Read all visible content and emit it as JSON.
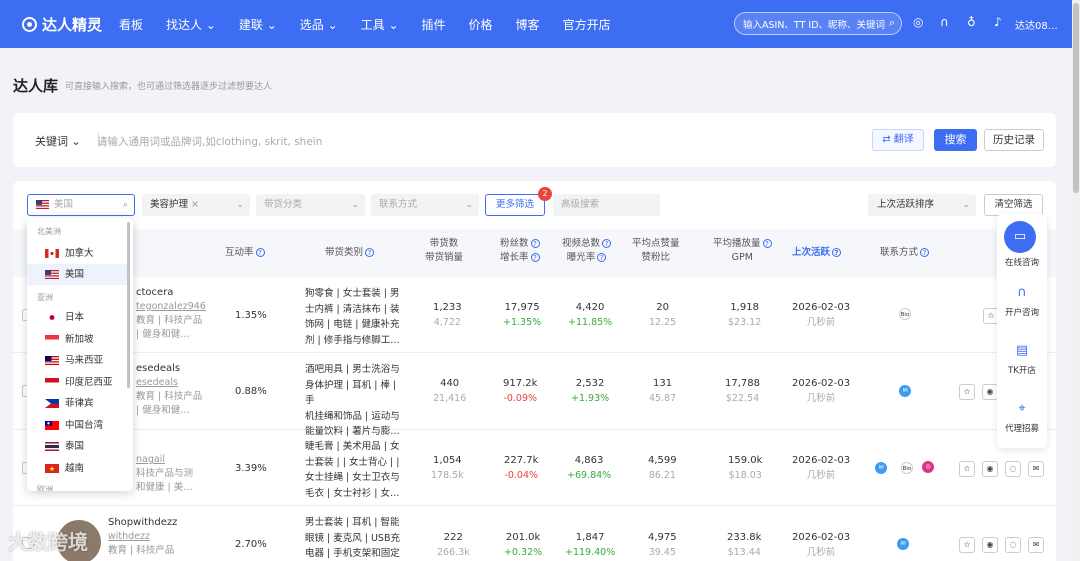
{
  "nav": {
    "brand": "达人精灵",
    "items": [
      "看板",
      "找达人 ⌄",
      "建联 ⌄",
      "选品 ⌄",
      "工具 ⌄",
      "插件",
      "价格",
      "博客",
      "官方开店"
    ],
    "search_placeholder": "输入ASIN、TT ID、昵称、关键词",
    "user": "达达08…"
  },
  "page": {
    "title": "达人库",
    "subtitle": "可直接输入搜索，也可通过筛选器逐步过滤想要达人"
  },
  "keyword": {
    "label": "关键词 ⌄",
    "placeholder": "请输入通用词或品牌词,如clothing, skrit, shein",
    "translate": "翻译",
    "search": "搜索",
    "history": "历史记录"
  },
  "filters": {
    "country_placeholder": "美国",
    "category": "美容护理",
    "goods_category": "带货分类",
    "contact": "联系方式",
    "more": "更多筛选",
    "more_count": "2",
    "advanced": "高级搜索",
    "sort": "上次活跃排序",
    "clear": "清空筛选"
  },
  "dropdown": {
    "groups": [
      {
        "label": "北美洲",
        "options": [
          "加拿大",
          "美国"
        ]
      },
      {
        "label": "亚洲",
        "options": [
          "日本",
          "新加坡",
          "马来西亚",
          "印度尼西亚",
          "菲律宾",
          "中国台湾",
          "泰国",
          "越南"
        ]
      },
      {
        "label": "欧洲",
        "options": []
      }
    ],
    "selected": "美国"
  },
  "table": {
    "headers": {
      "interaction": "互动率",
      "category": "带货类别",
      "goods": [
        "带货数",
        "带货销量"
      ],
      "fans": [
        "粉丝数",
        "增长率"
      ],
      "videos": [
        "视频总数",
        "曝光率"
      ],
      "likes": [
        "平均点赞量",
        "赞粉比"
      ],
      "plays": [
        "平均播放量",
        "GPM"
      ],
      "active": "上次活跃",
      "contact": "联系方式"
    },
    "rows": [
      {
        "name": "ctocera",
        "handle": "tegonzalez946",
        "tags": [
          "教育 | 科技产品",
          "| 健身和健…"
        ],
        "interaction": "1.35%",
        "category": [
          "狗零食 | 女士套装 | 男",
          "士内裤 | 清洁抹布 | 装",
          "饰网 | 电链 | 健康补充",
          "剂 | 修手指与修脚工…"
        ],
        "goods": "1,233",
        "sales": "4,722",
        "fans": "17,975",
        "growth": "+1.35%",
        "videos": "4,420",
        "exposure": "+11.85%",
        "likes": "20",
        "ratio": "12.25",
        "plays": "1,918",
        "gpm": "$23.12",
        "active_date": "2026-02-03",
        "active_ago": "几秒前",
        "contacts": [
          "Bio"
        ]
      },
      {
        "name": "esedeals",
        "handle": "esedeals",
        "tags": [
          "教育 | 科技产品",
          "| 健身和健…"
        ],
        "interaction": "0.88%",
        "category": [
          "酒吧用具 | 男士洗浴与",
          "身体护理 | 耳机 | 棒 | 手",
          "机挂绳和饰品 | 运动与",
          "能量饮料 | 薯片与膨…"
        ],
        "goods": "440",
        "sales": "21,416",
        "fans": "917.2k",
        "growth": "-0.09%",
        "videos": "2,532",
        "exposure": "+1.93%",
        "likes": "131",
        "ratio": "45.87",
        "plays": "17,788",
        "gpm": "$22.54",
        "active_date": "2026-02-03",
        "active_ago": "几秒前",
        "contacts": [
          "mail"
        ]
      },
      {
        "name": "",
        "handle": "nagail",
        "tags": [
          "科技产品与测",
          "和健康 | 美…"
        ],
        "interaction": "3.39%",
        "category": [
          "睫毛膏 | 美术用品 | 女",
          "士套装 | | 女士背心 | |",
          "女士挂绳 | 女士卫衣与",
          "毛衣 | 女士衬衫 | 女…"
        ],
        "goods": "1,054",
        "sales": "178.5k",
        "fans": "227.7k",
        "growth": "-0.04%",
        "videos": "4,863",
        "exposure": "+69.84%",
        "likes": "4,599",
        "ratio": "86.21",
        "plays": "159.0k",
        "gpm": "$18.03",
        "active_date": "2026-02-03",
        "active_ago": "几秒前",
        "contacts": [
          "mail",
          "Bio",
          "ig"
        ]
      },
      {
        "name": "Shopwithdezz",
        "handle": "withdezz",
        "tags": [
          "教育 | 科技产品"
        ],
        "interaction": "2.70%",
        "category": [
          "男士套装 | 耳机 | 智能",
          "眼镜 | 麦克风 | USB充",
          "电器 | 手机支架和固定"
        ],
        "goods": "222",
        "sales": "266.3k",
        "fans": "201.0k",
        "growth": "+0.32%",
        "videos": "1,847",
        "exposure": "+119.40%",
        "likes": "4,975",
        "ratio": "39.45",
        "plays": "233.8k",
        "gpm": "$13.44",
        "active_date": "2026-02-03",
        "active_ago": "几秒前",
        "contacts": [
          "mail"
        ]
      }
    ]
  },
  "sidebar": [
    {
      "label": "在线咨询",
      "icon": "chat-icon"
    },
    {
      "label": "开户咨询",
      "icon": "headset-icon"
    },
    {
      "label": "TK开店",
      "icon": "shop-icon"
    },
    {
      "label": "代理招募",
      "icon": "bookmark-icon"
    }
  ],
  "watermark": "大数跨境",
  "colors": {
    "primary": "#3d6df2",
    "up": "#3aaa3a",
    "down": "#e8453c"
  }
}
